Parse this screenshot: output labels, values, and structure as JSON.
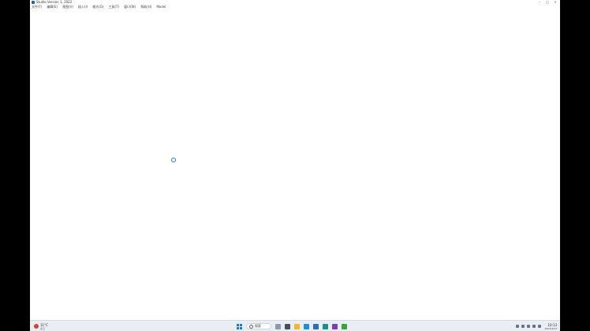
{
  "window": {
    "title": "Studio Version 1, 2022",
    "controls": {
      "minimize": "–",
      "maximize": "□",
      "close": "×"
    }
  },
  "menubar": {
    "items": [
      "文件(F)",
      "编辑(E)",
      "视图(V)",
      "插入(I)",
      "格式(O)",
      "工具(T)",
      "窗口(W)",
      "帮助(H)",
      "Model"
    ]
  },
  "taskbar": {
    "weather": {
      "temp": "11°C",
      "desc": "多云"
    },
    "search_label": "搜索",
    "pinned_icons": [
      {
        "name": "mountain-app-icon",
        "color": "#8a9bb0"
      },
      {
        "name": "task-view-icon",
        "color": "#4a4f57"
      },
      {
        "name": "file-explorer-icon",
        "color": "#f2b632"
      },
      {
        "name": "browser-icon",
        "color": "#1f8fd6"
      },
      {
        "name": "store-icon",
        "color": "#2a6fb8"
      },
      {
        "name": "app-teal-icon",
        "color": "#1b8f8a"
      },
      {
        "name": "app-purple-icon",
        "color": "#7a3fb0"
      },
      {
        "name": "app-green-icon",
        "color": "#3aa23a"
      }
    ],
    "clock": {
      "time": "10:13",
      "date": "2022/4/14"
    }
  },
  "colors": {
    "accent": "#1d78d6",
    "busy_cursor": "#1a7fc0"
  }
}
